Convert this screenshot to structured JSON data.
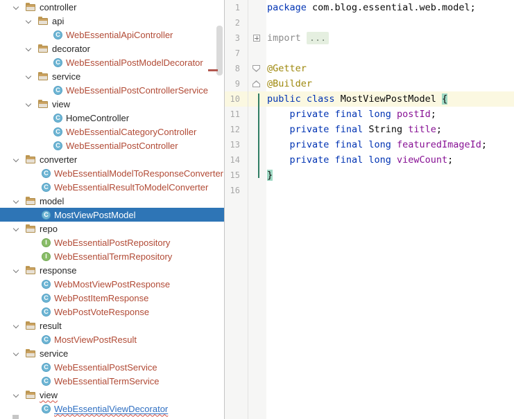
{
  "app": {
    "name": "intellij-idea-project-view-and-editor"
  },
  "colors": {
    "tree_selection_bg": "#2E75B6",
    "tree_modified_file_text": "#B14A35",
    "tree_link_text": "#2F6FC2",
    "editor_keyword": "#0033B3",
    "editor_field": "#871094",
    "editor_annotation": "#9E880D",
    "editor_current_line_bg": "#FBF8E1",
    "editor_brace_match_bg": "#9FD9C4",
    "error_stripe": "#B2574E"
  },
  "project_tree": {
    "rows": [
      {
        "label": "controller",
        "kind": "folder",
        "level": 1
      },
      {
        "label": "api",
        "kind": "folder",
        "level": 2
      },
      {
        "label": "WebEssentialApiController",
        "kind": "class",
        "level": 3,
        "color": "red"
      },
      {
        "label": "decorator",
        "kind": "folder",
        "level": 2
      },
      {
        "label": "WebEssentialPostModelDecorator",
        "kind": "class",
        "level": 3,
        "color": "red"
      },
      {
        "label": "service",
        "kind": "folder",
        "level": 2
      },
      {
        "label": "WebEssentialPostControllerService",
        "kind": "class",
        "level": 3,
        "color": "red"
      },
      {
        "label": "view",
        "kind": "folder",
        "level": 2
      },
      {
        "label": "HomeController",
        "kind": "class",
        "level": 3,
        "color": "default"
      },
      {
        "label": "WebEssentialCategoryController",
        "kind": "class",
        "level": 3,
        "color": "red"
      },
      {
        "label": "WebEssentialPostController",
        "kind": "class",
        "level": 3,
        "color": "red"
      },
      {
        "label": "converter",
        "kind": "folder",
        "level": 1
      },
      {
        "label": "WebEssentialModelToResponseConverter",
        "kind": "class",
        "level": 2,
        "color": "red"
      },
      {
        "label": "WebEssentialResultToModelConverter",
        "kind": "class",
        "level": 2,
        "color": "red"
      },
      {
        "label": "model",
        "kind": "folder",
        "level": 1
      },
      {
        "label": "MostViewPostModel",
        "kind": "class",
        "level": 2,
        "selected": true
      },
      {
        "label": "repo",
        "kind": "folder",
        "level": 1
      },
      {
        "label": "WebEssentialPostRepository",
        "kind": "interface",
        "level": 2,
        "color": "red"
      },
      {
        "label": "WebEssentialTermRepository",
        "kind": "interface",
        "level": 2,
        "color": "red"
      },
      {
        "label": "response",
        "kind": "folder",
        "level": 1
      },
      {
        "label": "WebMostViewPostResponse",
        "kind": "class",
        "level": 2,
        "color": "red"
      },
      {
        "label": "WebPostItemResponse",
        "kind": "class",
        "level": 2,
        "color": "red"
      },
      {
        "label": "WebPostVoteResponse",
        "kind": "class",
        "level": 2,
        "color": "red"
      },
      {
        "label": "result",
        "kind": "folder",
        "level": 1
      },
      {
        "label": "MostViewPostResult",
        "kind": "class",
        "level": 2,
        "color": "red"
      },
      {
        "label": "service",
        "kind": "folder",
        "level": 1
      },
      {
        "label": "WebEssentialPostService",
        "kind": "class",
        "level": 2,
        "color": "red"
      },
      {
        "label": "WebEssentialTermService",
        "kind": "class",
        "level": 2,
        "color": "red"
      },
      {
        "label": "view",
        "kind": "folder",
        "level": 1,
        "squiggle": true
      },
      {
        "label": "WebEssentialViewDecorator",
        "kind": "class",
        "level": 2,
        "color": "link",
        "squiggle": true,
        "underline": true
      }
    ]
  },
  "editor": {
    "lines": [
      {
        "num": 1,
        "tokens": [
          [
            "kw",
            "package"
          ],
          [
            "pl",
            " com.blog.essential.web.model;"
          ]
        ]
      },
      {
        "num": 2,
        "tokens": []
      },
      {
        "num": 3,
        "fold": "plus",
        "tokens": [
          [
            "fold",
            "import "
          ],
          [
            "dots",
            "..."
          ]
        ]
      },
      {
        "num": 7,
        "tokens": []
      },
      {
        "num": 8,
        "fold": "down",
        "tokens": [
          [
            "ann",
            "@Getter"
          ]
        ]
      },
      {
        "num": 9,
        "fold": "up",
        "tokens": [
          [
            "ann",
            "@Builder"
          ]
        ]
      },
      {
        "num": 10,
        "current": true,
        "tokens": [
          [
            "kw",
            "public"
          ],
          [
            "pl",
            " "
          ],
          [
            "kw",
            "class"
          ],
          [
            "pl",
            " MostViewPostModel "
          ],
          [
            "br",
            "{"
          ]
        ]
      },
      {
        "num": 11,
        "tokens": [
          [
            "pl",
            "    "
          ],
          [
            "kw",
            "private"
          ],
          [
            "pl",
            " "
          ],
          [
            "kw",
            "final"
          ],
          [
            "pl",
            " "
          ],
          [
            "kw",
            "long"
          ],
          [
            "pl",
            " "
          ],
          [
            "fld",
            "postId"
          ],
          [
            "pl",
            ";"
          ]
        ]
      },
      {
        "num": 12,
        "tokens": [
          [
            "pl",
            "    "
          ],
          [
            "kw",
            "private"
          ],
          [
            "pl",
            " "
          ],
          [
            "kw",
            "final"
          ],
          [
            "pl",
            " String "
          ],
          [
            "fld",
            "title"
          ],
          [
            "pl",
            ";"
          ]
        ]
      },
      {
        "num": 13,
        "tokens": [
          [
            "pl",
            "    "
          ],
          [
            "kw",
            "private"
          ],
          [
            "pl",
            " "
          ],
          [
            "kw",
            "final"
          ],
          [
            "pl",
            " "
          ],
          [
            "kw",
            "long"
          ],
          [
            "pl",
            " "
          ],
          [
            "fld",
            "featuredImageId"
          ],
          [
            "pl",
            ";"
          ]
        ]
      },
      {
        "num": 14,
        "tokens": [
          [
            "pl",
            "    "
          ],
          [
            "kw",
            "private"
          ],
          [
            "pl",
            " "
          ],
          [
            "kw",
            "final"
          ],
          [
            "pl",
            " "
          ],
          [
            "kw",
            "long"
          ],
          [
            "pl",
            " "
          ],
          [
            "fld",
            "viewCount"
          ],
          [
            "pl",
            ";"
          ]
        ]
      },
      {
        "num": 15,
        "tokens": [
          [
            "br",
            "}"
          ]
        ]
      },
      {
        "num": 16,
        "tokens": []
      }
    ]
  }
}
